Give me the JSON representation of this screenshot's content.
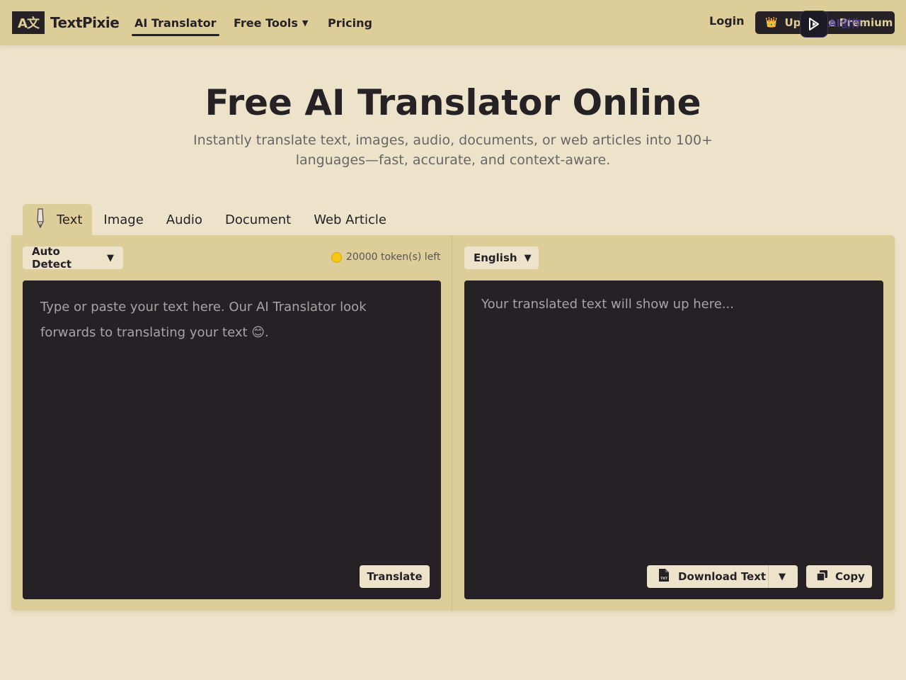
{
  "header": {
    "logo_mark": "A文",
    "logo_text": "TextPixie",
    "nav": {
      "ai_translator": "AI Translator",
      "free_tools": "Free Tools",
      "pricing": "Pricing"
    },
    "login": "Login",
    "upgrade_label": "Upgrade Premium",
    "extension_text": "AI创作"
  },
  "hero": {
    "title": "Free AI Translator Online",
    "subtitle": "Instantly translate text, images, audio, documents, or web articles into 100+ languages—fast, accurate, and context-aware."
  },
  "tabs": [
    {
      "label": "Text",
      "active": true
    },
    {
      "label": "Image"
    },
    {
      "label": "Audio"
    },
    {
      "label": "Document"
    },
    {
      "label": "Web Article"
    }
  ],
  "translator": {
    "source_language": "Auto Detect",
    "target_language": "English",
    "tokens_left": "20000 token(s) left",
    "source_placeholder": "Type or paste your text here. Our AI Translator look forwards to translating your text 😊.",
    "target_placeholder": "Your translated text will show up here...",
    "translate_label": "Translate",
    "download_label": "Download Text",
    "copy_label": "Copy"
  },
  "colors": {
    "background": "#ede3cb",
    "header": "#ddcd99",
    "dark": "#262124",
    "muted_text": "#6a6566"
  }
}
